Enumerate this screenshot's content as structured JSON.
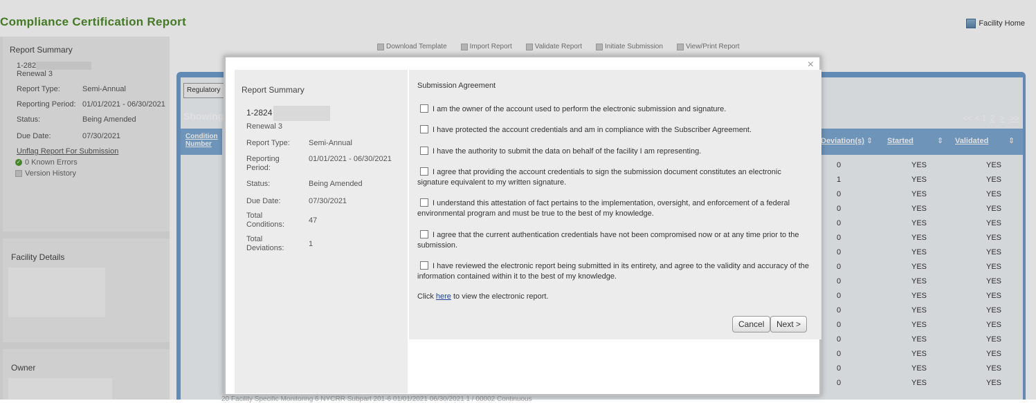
{
  "header": {
    "title": "Compliance Certification Report",
    "facility_home": "Facility Home"
  },
  "sidebar": {
    "summary_title": "Report Summary",
    "report_id": "1-282",
    "renewal": "Renewal 3",
    "rows": [
      {
        "label": "Report Type:",
        "value": "Semi-Annual"
      },
      {
        "label": "Reporting Period:",
        "value": "01/01/2021 - 06/30/2021"
      },
      {
        "label": "Status:",
        "value": "Being Amended"
      },
      {
        "label": "Due Date:",
        "value": "07/30/2021"
      }
    ],
    "unflag_link": "Unflag Report For Submission",
    "known_errors": "0 Known Errors",
    "version_history": "Version History",
    "facility_details": "Facility Details",
    "owner": "Owner"
  },
  "toolbar": {
    "items": [
      "Download Template",
      "Import Report",
      "Validate Report",
      "Initiate Submission",
      "View/Print Report"
    ]
  },
  "main": {
    "regulatory_tab": "Regulatory",
    "showing": "Showing",
    "pager": {
      "first": "<<",
      "prev": "<",
      "page1": "1",
      "page2": "2",
      "next": ">",
      "last": ">>"
    },
    "condition_col": "Condition Number",
    "columns": {
      "deviations": "Deviation(s)",
      "started": "Started",
      "validated": "Validated"
    },
    "rows": [
      {
        "dev": "0",
        "started": "YES",
        "validated": "YES"
      },
      {
        "dev": "1",
        "started": "YES",
        "validated": "YES"
      },
      {
        "dev": "0",
        "started": "YES",
        "validated": "YES"
      },
      {
        "dev": "0",
        "started": "YES",
        "validated": "YES"
      },
      {
        "dev": "0",
        "started": "YES",
        "validated": "YES"
      },
      {
        "dev": "0",
        "started": "YES",
        "validated": "YES"
      },
      {
        "dev": "0",
        "started": "YES",
        "validated": "YES"
      },
      {
        "dev": "0",
        "started": "YES",
        "validated": "YES"
      },
      {
        "dev": "0",
        "started": "YES",
        "validated": "YES"
      },
      {
        "dev": "0",
        "started": "YES",
        "validated": "YES"
      },
      {
        "dev": "0",
        "started": "YES",
        "validated": "YES"
      },
      {
        "dev": "0",
        "started": "YES",
        "validated": "YES"
      },
      {
        "dev": "0",
        "started": "YES",
        "validated": "YES"
      },
      {
        "dev": "0",
        "started": "YES",
        "validated": "YES"
      },
      {
        "dev": "0",
        "started": "YES",
        "validated": "YES"
      },
      {
        "dev": "0",
        "started": "YES",
        "validated": "YES"
      }
    ],
    "faded_row": "20    Facility Specific Monitoring    6 NYCRR Subpart 201-6    01/01/2021    06/30/2021    1 / 00002    Continuous"
  },
  "modal": {
    "close": "×",
    "summary_title": "Report Summary",
    "report_id": "1-2824",
    "renewal": "Renewal 3",
    "rows": [
      {
        "label": "Report Type:",
        "value": "Semi-Annual"
      },
      {
        "label": "Reporting Period:",
        "value": "01/01/2021 - 06/30/2021"
      },
      {
        "label": "Status:",
        "value": "Being Amended"
      },
      {
        "label": "Due Date:",
        "value": "07/30/2021"
      },
      {
        "label": "Total Conditions:",
        "value": "47"
      },
      {
        "label": "Total Deviations:",
        "value": "1"
      }
    ],
    "agreement_title": "Submission Agreement",
    "agreements": [
      "I am the owner of the account used to perform the electronic submission and signature.",
      "I have protected the account credentials and am in compliance with the Subscriber Agreement.",
      "I have the authority to submit the data on behalf of the facility I am representing.",
      "I agree that providing the account credentials to sign the submission document constitutes an electronic signature equivalent to my written signature.",
      "I understand this attestation of fact pertains to the implementation, oversight, and enforcement of a federal environmental program and must be true to the best of my knowledge.",
      "I agree that the current authentication credentials have not been compromised now or at any time prior to the submission.",
      "I have reviewed the electronic report being submitted in its entirety, and agree to the validity and accuracy of the information contained within it to the best of my knowledge."
    ],
    "click_prefix": "Click ",
    "click_link": "here",
    "click_suffix": " to view the electronic report.",
    "cancel": "Cancel",
    "next": "Next >"
  }
}
